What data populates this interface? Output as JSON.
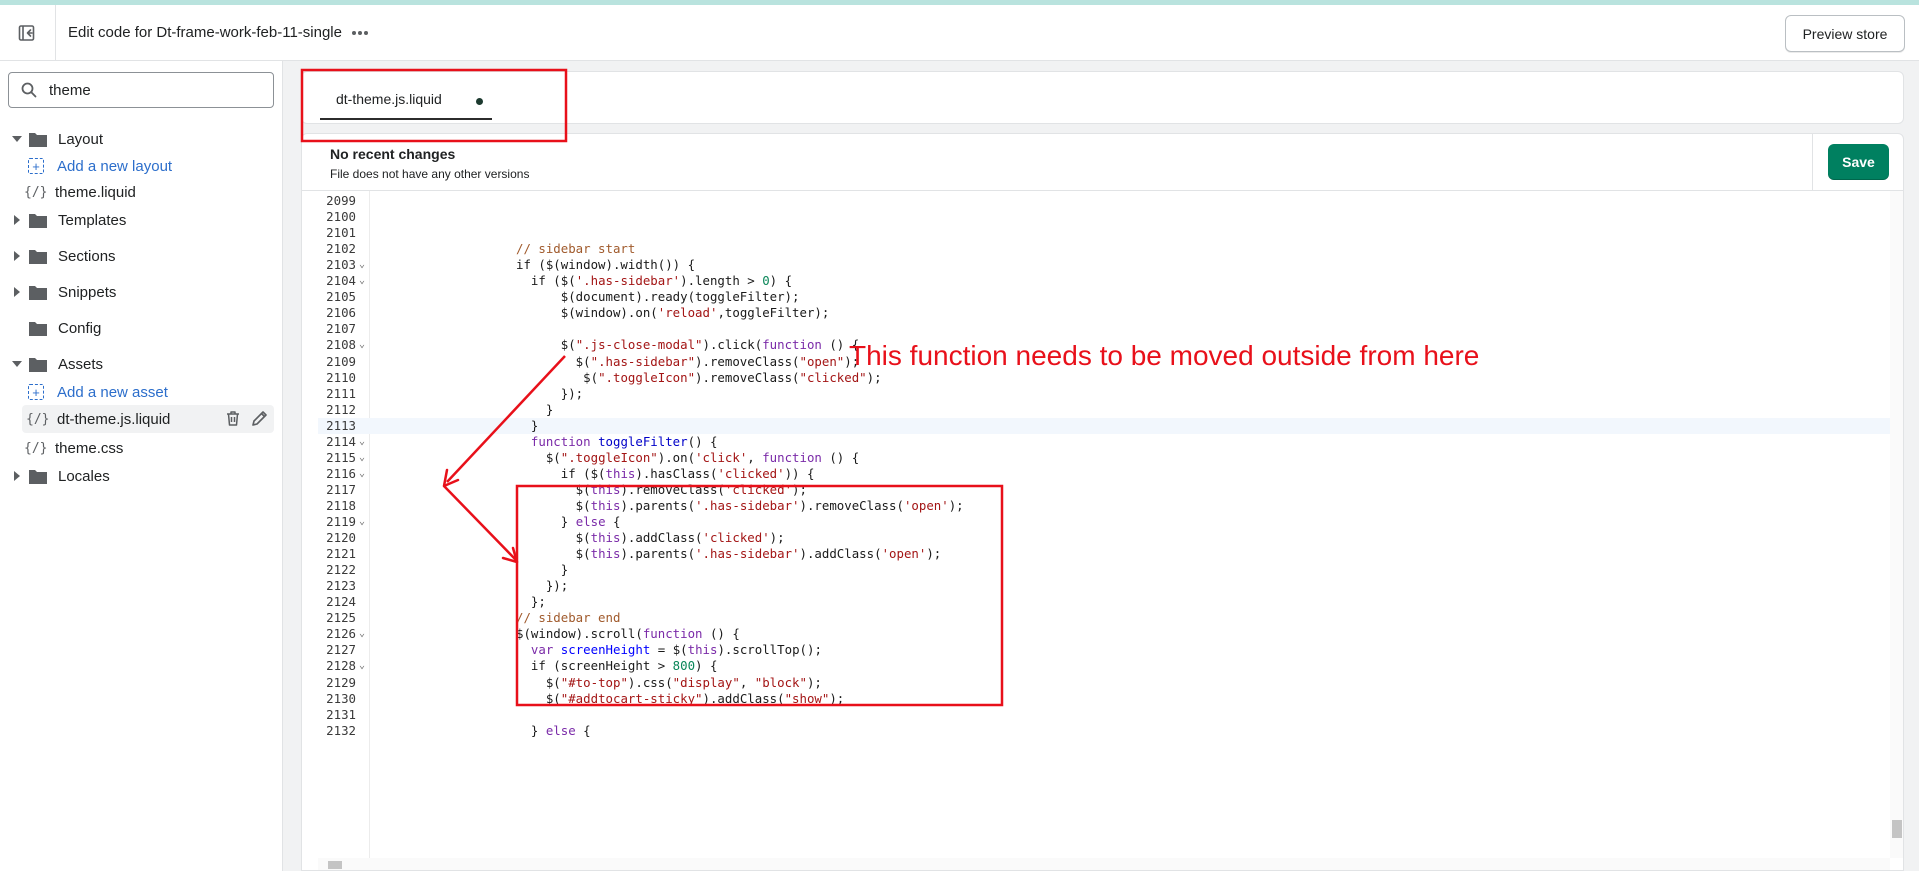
{
  "topbar": {
    "title": "Edit code for Dt-frame-work-feb-11-single",
    "more_label": "•••",
    "preview_label": "Preview store"
  },
  "sidebar": {
    "search_value": "theme",
    "items": [
      {
        "type": "folder",
        "label": "Layout",
        "expanded": true
      },
      {
        "type": "add",
        "label": "Add a new layout"
      },
      {
        "type": "file",
        "label": "theme.liquid",
        "icon": "{/}"
      },
      {
        "type": "folder",
        "label": "Templates",
        "expanded": false
      },
      {
        "type": "folder",
        "label": "Sections",
        "expanded": false
      },
      {
        "type": "folder",
        "label": "Snippets",
        "expanded": false
      },
      {
        "type": "folder",
        "label": "Config",
        "expanded": null
      },
      {
        "type": "folder",
        "label": "Assets",
        "expanded": true
      },
      {
        "type": "add",
        "label": "Add a new asset"
      },
      {
        "type": "file",
        "label": "dt-theme.js.liquid",
        "icon": "{/}",
        "selected": true
      },
      {
        "type": "file",
        "label": "theme.css",
        "icon": "{/}"
      },
      {
        "type": "folder",
        "label": "Locales",
        "expanded": false
      }
    ]
  },
  "tab": {
    "label": "dt-theme.js.liquid"
  },
  "editor": {
    "recent_title": "No recent changes",
    "recent_subtitle": "File does not have any other versions",
    "save_label": "Save"
  },
  "code_lines": [
    {
      "n": "2099",
      "fold": "",
      "text": ""
    },
    {
      "n": "2100",
      "fold": "",
      "text": ""
    },
    {
      "n": "2101",
      "fold": "",
      "text": ""
    },
    {
      "n": "2102",
      "fold": "",
      "text": "// sidebar start"
    },
    {
      "n": "2103",
      "fold": "v",
      "text": "if ($(window).width()) {"
    },
    {
      "n": "2104",
      "fold": "v",
      "text": "  if ($('.has-sidebar').length > 0) {"
    },
    {
      "n": "2105",
      "fold": "",
      "text": "      $(document).ready(toggleFilter);"
    },
    {
      "n": "2106",
      "fold": "",
      "text": "      $(window).on('reload',toggleFilter);"
    },
    {
      "n": "2107",
      "fold": "",
      "text": ""
    },
    {
      "n": "2108",
      "fold": "v",
      "text": "      $(\".js-close-modal\").click(function () {"
    },
    {
      "n": "2109",
      "fold": "",
      "text": "        $(\".has-sidebar\").removeClass(\"open\");"
    },
    {
      "n": "2110",
      "fold": "",
      "text": "         $(\".toggleIcon\").removeClass(\"clicked\");"
    },
    {
      "n": "2111",
      "fold": "",
      "text": "      });"
    },
    {
      "n": "2112",
      "fold": "",
      "text": "    }"
    },
    {
      "n": "2113",
      "fold": "",
      "text": "  }"
    },
    {
      "n": "2114",
      "fold": "v",
      "text": "  function toggleFilter() {"
    },
    {
      "n": "2115",
      "fold": "v",
      "text": "    $(\".toggleIcon\").on('click', function () {"
    },
    {
      "n": "2116",
      "fold": "v",
      "text": "      if ($(this).hasClass('clicked')) {"
    },
    {
      "n": "2117",
      "fold": "",
      "text": "        $(this).removeClass('clicked');"
    },
    {
      "n": "2118",
      "fold": "",
      "text": "        $(this).parents('.has-sidebar').removeClass('open');"
    },
    {
      "n": "2119",
      "fold": "v",
      "text": "      } else {"
    },
    {
      "n": "2120",
      "fold": "",
      "text": "        $(this).addClass('clicked');"
    },
    {
      "n": "2121",
      "fold": "",
      "text": "        $(this).parents('.has-sidebar').addClass('open');"
    },
    {
      "n": "2122",
      "fold": "",
      "text": "      }"
    },
    {
      "n": "2123",
      "fold": "",
      "text": "    });"
    },
    {
      "n": "2124",
      "fold": "",
      "text": "  };"
    },
    {
      "n": "2125",
      "fold": "",
      "text": "// sidebar end"
    },
    {
      "n": "2126",
      "fold": "v",
      "text": "$(window).scroll(function () {"
    },
    {
      "n": "2127",
      "fold": "",
      "text": "  var screenHeight = $(this).scrollTop();"
    },
    {
      "n": "2128",
      "fold": "v",
      "text": "  if (screenHeight > 800) {"
    },
    {
      "n": "2129",
      "fold": "",
      "text": "    $(\"#to-top\").css(\"display\", \"block\");"
    },
    {
      "n": "2130",
      "fold": "",
      "text": "    $(\"#addtocart-sticky\").addClass(\"show\");"
    },
    {
      "n": "2131",
      "fold": "",
      "text": ""
    },
    {
      "n": "2132",
      "fold": "",
      "text": "  } else {"
    }
  ],
  "active_line": "2113",
  "annotation": {
    "text": "This function needs to be moved outside from here",
    "color": "#e8101a"
  },
  "colors": {
    "accent_green": "#008060",
    "link_blue": "#2c6ecb",
    "annotation_red": "#e8101a"
  }
}
